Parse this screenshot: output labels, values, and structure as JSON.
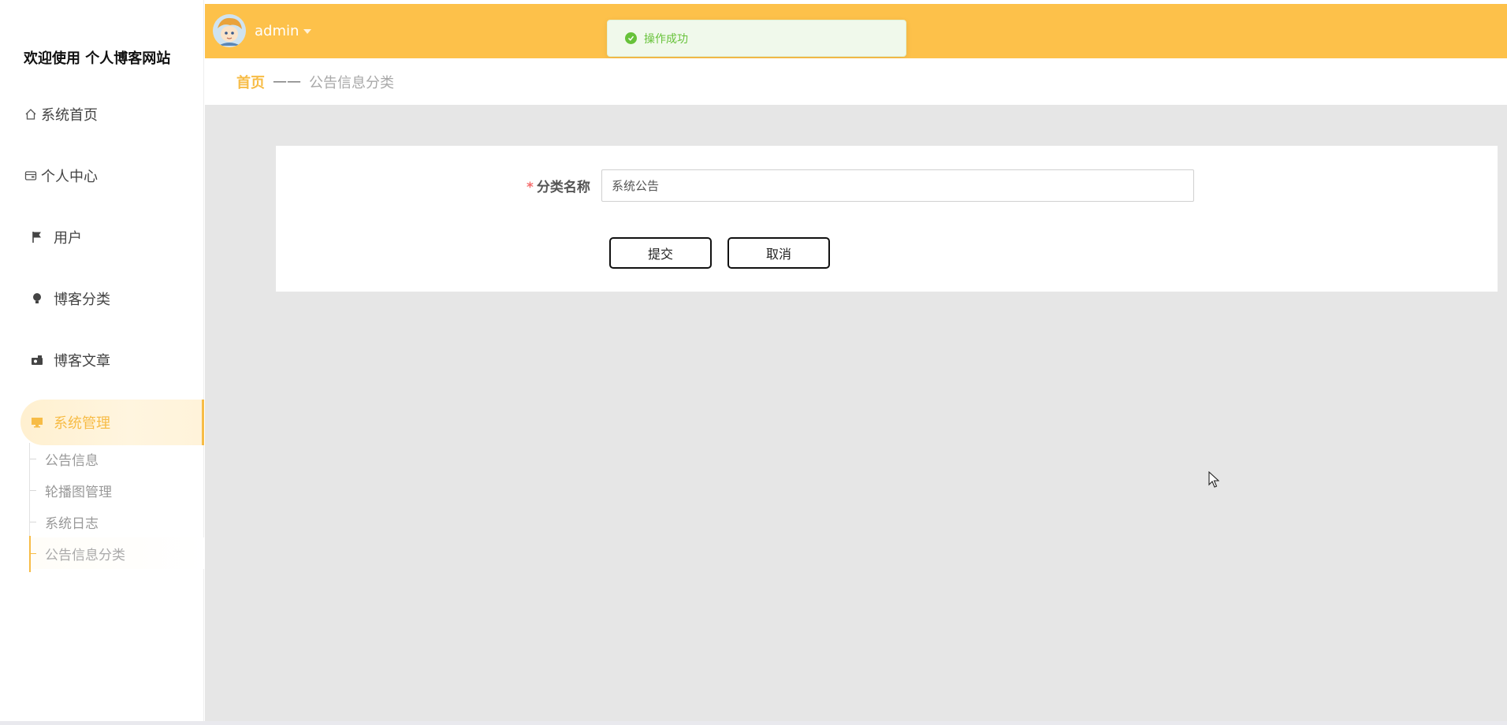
{
  "sidebar": {
    "title": "欢迎使用 个人博客网站",
    "items": [
      {
        "label": "系统首页",
        "icon": "home-icon"
      },
      {
        "label": "个人中心",
        "icon": "wallet-icon"
      },
      {
        "label": "用户",
        "icon": "flag-icon"
      },
      {
        "label": "博客分类",
        "icon": "bulb-icon"
      },
      {
        "label": "博客文章",
        "icon": "camera-icon"
      },
      {
        "label": "系统管理",
        "icon": "monitor-icon",
        "active": true
      }
    ],
    "submenu": [
      {
        "label": "公告信息"
      },
      {
        "label": "轮播图管理"
      },
      {
        "label": "系统日志"
      },
      {
        "label": "公告信息分类",
        "active": true
      }
    ]
  },
  "header": {
    "username": "admin"
  },
  "toast": {
    "message": "操作成功"
  },
  "breadcrumb": {
    "home": "首页",
    "separator": "——",
    "current": "公告信息分类"
  },
  "form": {
    "required_mark": "*",
    "field_label": "分类名称",
    "field_value": "系统公告",
    "submit_label": "提交",
    "cancel_label": "取消"
  },
  "colors": {
    "accent": "#fdc14a",
    "active_text": "#f7bc46",
    "success": "#67c23a",
    "content_bg": "#e6e6e6"
  }
}
